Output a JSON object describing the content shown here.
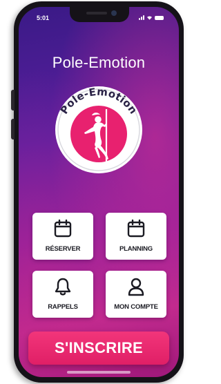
{
  "status_bar": {
    "time": "5:01"
  },
  "header": {
    "title": "Pole-Emotion"
  },
  "logo": {
    "text": "Pole-Emotion",
    "accent_color": "#e8216f"
  },
  "menu": {
    "tiles": [
      {
        "label": "RÉSERVER",
        "icon": "calendar-icon"
      },
      {
        "label": "PLANNING",
        "icon": "calendar-icon"
      },
      {
        "label": "RAPPELS",
        "icon": "bell-icon"
      },
      {
        "label": "MON COMPTE",
        "icon": "user-icon"
      }
    ]
  },
  "cta": {
    "label": "S'INSCRIRE",
    "color": "#e8216f"
  }
}
